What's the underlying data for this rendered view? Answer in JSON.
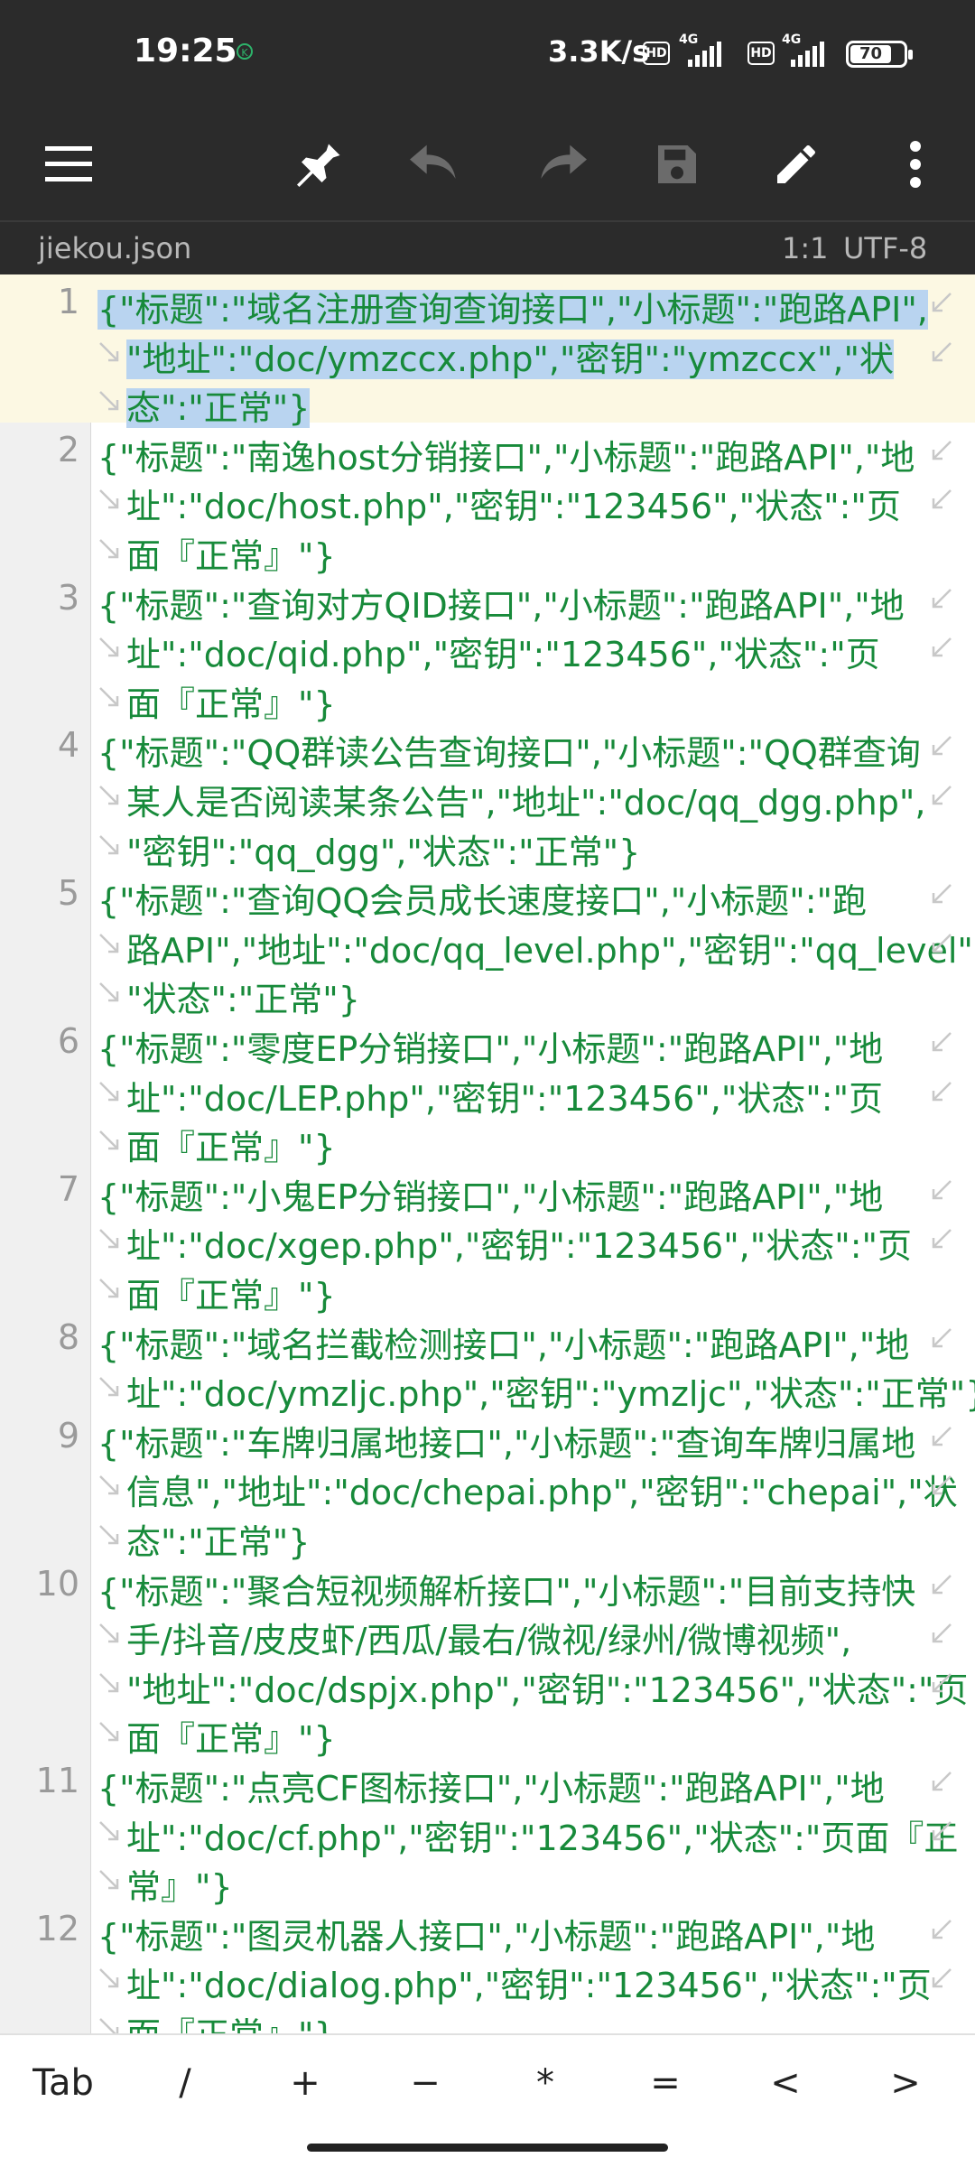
{
  "status_bar": {
    "time": "19:25",
    "net_speed": "3.3K/s",
    "hd_badge": "HD",
    "network_type": "4G",
    "battery": "70"
  },
  "toolbar": {
    "icons": [
      "menu-icon",
      "pin-icon",
      "undo-icon",
      "redo-icon",
      "save-icon",
      "edit-icon",
      "more-icon"
    ]
  },
  "file_bar": {
    "filename": "jiekou.json",
    "position": "1:1",
    "encoding": "UTF-8"
  },
  "editor": {
    "lines": [
      {
        "n": "1",
        "v": [
          "{\"标题\":\"域名注册查询查询接口\",\"小标题\":\"跑路API\",",
          "\"地址\":\"doc/ymzccx.php\",\"密钥\":\"ymzccx\",\"状",
          "态\":\"正常\"}"
        ]
      },
      {
        "n": "2",
        "v": [
          "{\"标题\":\"南逸host分销接口\",\"小标题\":\"跑路API\",\"地",
          "址\":\"doc/host.php\",\"密钥\":\"123456\",\"状态\":\"页",
          "面『正常』\"}"
        ]
      },
      {
        "n": "3",
        "v": [
          "{\"标题\":\"查询对方QID接口\",\"小标题\":\"跑路API\",\"地",
          "址\":\"doc/qid.php\",\"密钥\":\"123456\",\"状态\":\"页",
          "面『正常』\"}"
        ]
      },
      {
        "n": "4",
        "v": [
          "{\"标题\":\"QQ群读公告查询接口\",\"小标题\":\"QQ群查询",
          "某人是否阅读某条公告\",\"地址\":\"doc/qq_dgg.php\",",
          "\"密钥\":\"qq_dgg\",\"状态\":\"正常\"}"
        ]
      },
      {
        "n": "5",
        "v": [
          "{\"标题\":\"查询QQ会员成长速度接口\",\"小标题\":\"跑",
          "路API\",\"地址\":\"doc/qq_level.php\",\"密钥\":\"qq_level\",",
          "\"状态\":\"正常\"}"
        ]
      },
      {
        "n": "6",
        "v": [
          "{\"标题\":\"零度EP分销接口\",\"小标题\":\"跑路API\",\"地",
          "址\":\"doc/LEP.php\",\"密钥\":\"123456\",\"状态\":\"页",
          "面『正常』\"}"
        ]
      },
      {
        "n": "7",
        "v": [
          "{\"标题\":\"小鬼EP分销接口\",\"小标题\":\"跑路API\",\"地",
          "址\":\"doc/xgep.php\",\"密钥\":\"123456\",\"状态\":\"页",
          "面『正常』\"}"
        ]
      },
      {
        "n": "8",
        "v": [
          "{\"标题\":\"域名拦截检测接口\",\"小标题\":\"跑路API\",\"地",
          "址\":\"doc/ymzljc.php\",\"密钥\":\"ymzljc\",\"状态\":\"正常\"}"
        ]
      },
      {
        "n": "9",
        "v": [
          "{\"标题\":\"车牌归属地接口\",\"小标题\":\"查询车牌归属地",
          "信息\",\"地址\":\"doc/chepai.php\",\"密钥\":\"chepai\",\"状",
          "态\":\"正常\"}"
        ]
      },
      {
        "n": "10",
        "v": [
          "{\"标题\":\"聚合短视频解析接口\",\"小标题\":\"目前支持快",
          "手/抖音/皮皮虾/西瓜/最右/微视/绿州/微博视频\",",
          "\"地址\":\"doc/dspjx.php\",\"密钥\":\"123456\",\"状态\":\"页",
          "面『正常』\"}"
        ]
      },
      {
        "n": "11",
        "v": [
          "{\"标题\":\"点亮CF图标接口\",\"小标题\":\"跑路API\",\"地",
          "址\":\"doc/cf.php\",\"密钥\":\"123456\",\"状态\":\"页面『正",
          "常』\"}"
        ]
      },
      {
        "n": "12",
        "v": [
          "{\"标题\":\"图灵机器人接口\",\"小标题\":\"跑路API\",\"地",
          "址\":\"doc/dialog.php\",\"密钥\":\"123456\",\"状态\":\"页",
          "面『正常』\"}"
        ]
      }
    ]
  },
  "keybar": {
    "keys": [
      "Tab",
      "/",
      "+",
      "−",
      "*",
      "=",
      "<",
      ">"
    ]
  },
  "colors": {
    "toolbar_bg": "#2b2b2b",
    "code_text": "#178a3a",
    "current_line": "#fcf8e3",
    "selection": "#b9d4f0"
  }
}
